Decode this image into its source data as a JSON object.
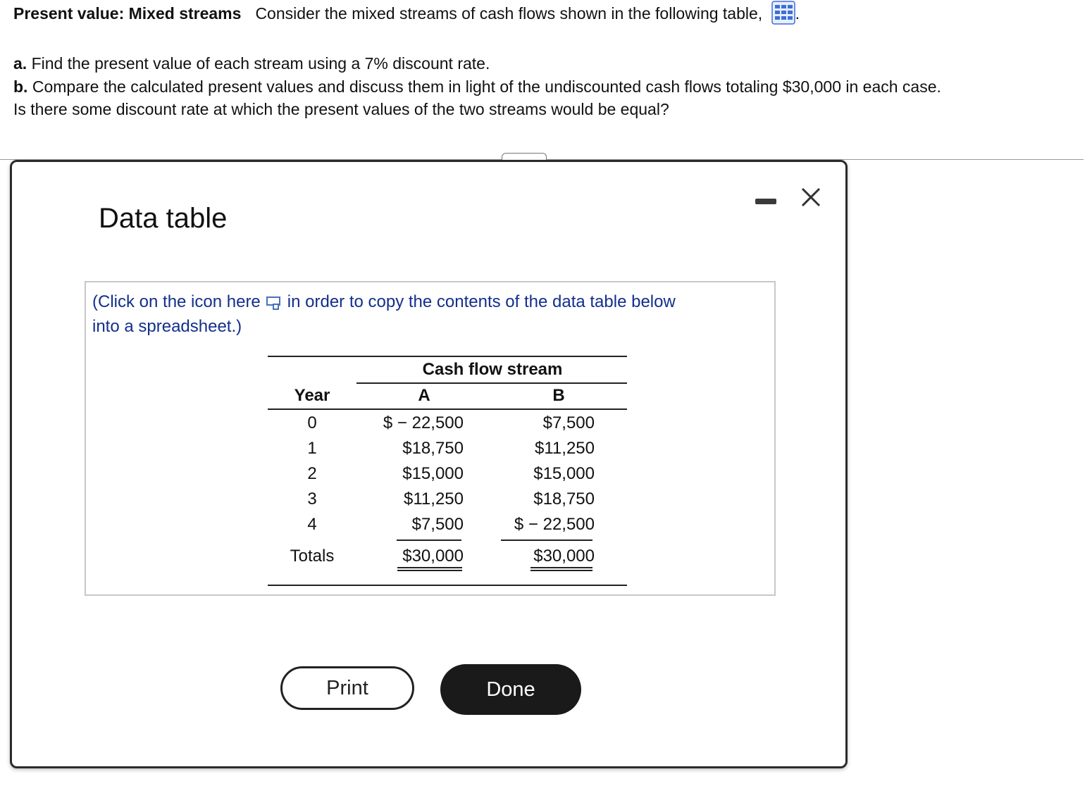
{
  "question": {
    "title": "Present value: Mixed streams",
    "intro": "Consider the mixed streams of cash flows shown in the following table,",
    "intro_end": ".",
    "part_a_label": "a.",
    "part_a_text": "Find the present value of each stream using a 7% discount rate.",
    "part_b_label": "b.",
    "part_b_text": "Compare the calculated present values and discuss them in light of the undiscounted cash flows totaling $30,000 in each case.",
    "part_b_text2": "Is there some discount rate at which the present values of the two streams would be equal?"
  },
  "dialog": {
    "title": "Data table",
    "instruction_part1": "(Click on the icon here",
    "instruction_part2": "in order to copy the contents of the data table below",
    "instruction_part3": "into a spreadsheet.)",
    "print_label": "Print",
    "done_label": "Done"
  },
  "table": {
    "group_header": "Cash flow stream",
    "year_header": "Year",
    "col_a_header": "A",
    "col_b_header": "B",
    "rows": [
      {
        "year": "0",
        "a": "$ − 22,500",
        "b": "$7,500"
      },
      {
        "year": "1",
        "a": "$18,750",
        "b": "$11,250"
      },
      {
        "year": "2",
        "a": "$15,000",
        "b": "$15,000"
      },
      {
        "year": "3",
        "a": "$11,250",
        "b": "$18,750"
      },
      {
        "year": "4",
        "a": "$7,500",
        "b": "$ − 22,500"
      }
    ],
    "totals_label": "Totals",
    "total_a": "$30,000",
    "total_b": "$30,000"
  }
}
